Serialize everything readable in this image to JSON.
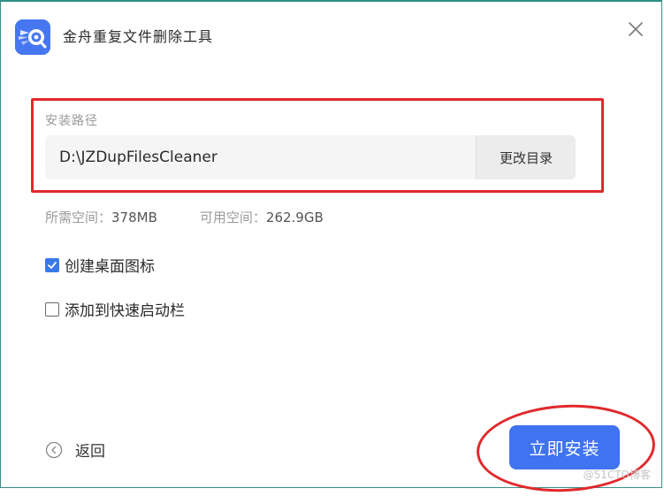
{
  "window": {
    "title": "金舟重复文件删除工具",
    "accent_color": "#3f73ef",
    "highlight_color": "#e0292c"
  },
  "icons": {
    "app": "app-logo-icon",
    "close": "close-icon",
    "back": "back-arrow-icon",
    "check": "checkmark-icon"
  },
  "install_path": {
    "label": "安装路径",
    "value": "D:\\JZDupFilesCleaner",
    "change_button": "更改目录"
  },
  "space": {
    "required_label": "所需空间：",
    "required_value": "378MB",
    "available_label": "可用空间：",
    "available_value": "262.9GB"
  },
  "options": {
    "desktop_icon": {
      "label": "创建桌面图标",
      "checked": true
    },
    "quick_launch": {
      "label": "添加到快速启动栏",
      "checked": false
    }
  },
  "footer": {
    "back_label": "返回",
    "install_label": "立即安装",
    "watermark": "@51CTO博客"
  }
}
